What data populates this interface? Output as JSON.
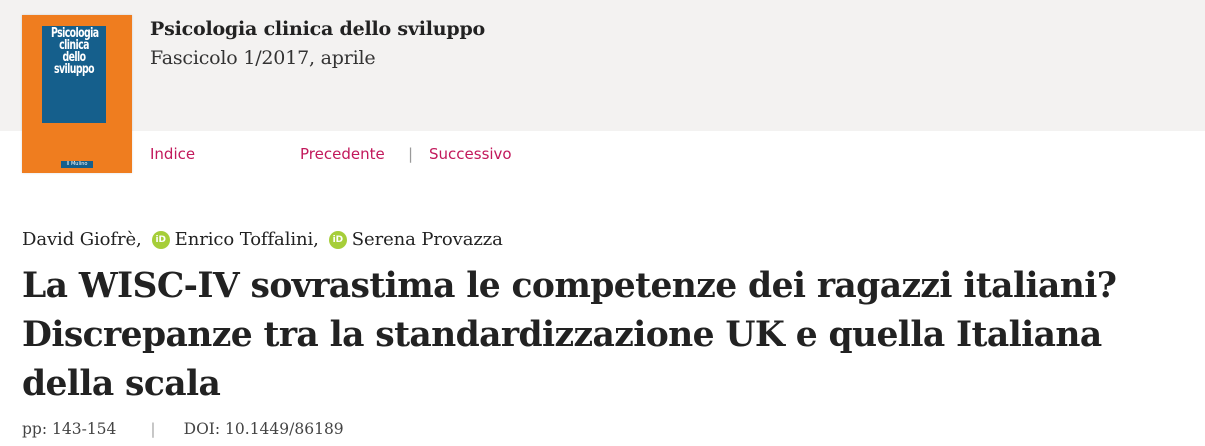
{
  "issue_header": {
    "cover": {
      "title_lines": [
        "Psicologia",
        "clinica",
        "dello",
        "sviluppo"
      ],
      "publisher_logo": "Il Mulino",
      "colors": {
        "background": "#ef7d1f",
        "panel": "#155f8c"
      }
    },
    "journal_title": "Psicologia clinica dello sviluppo",
    "issue": "Fascicolo 1/2017, aprile",
    "nav": {
      "index": "Indice",
      "previous": "Precedente",
      "separator": "|",
      "next": "Successivo"
    }
  },
  "article": {
    "authors": [
      {
        "name": "David Giofrè",
        "suffix": ","
      },
      {
        "name": "Enrico Toffalini",
        "suffix": ",",
        "orcid_icon": "orcid-icon"
      },
      {
        "name": "Serena Provazza",
        "suffix": "",
        "orcid_icon": "orcid-icon"
      }
    ],
    "orcid_badge_text": "iD",
    "title": "La WISC-IV sovrastima le competenze dei ragazzi italiani? Discrepanze tra la standardizzazione UK e quella Italiana della scala",
    "pages": "pp: 143-154",
    "separator": "|",
    "doi": "DOI: 10.1449/86189"
  },
  "colors": {
    "link": "#c2185b",
    "orcid": "#a6ce39",
    "header_band": "#f3f2f1"
  }
}
